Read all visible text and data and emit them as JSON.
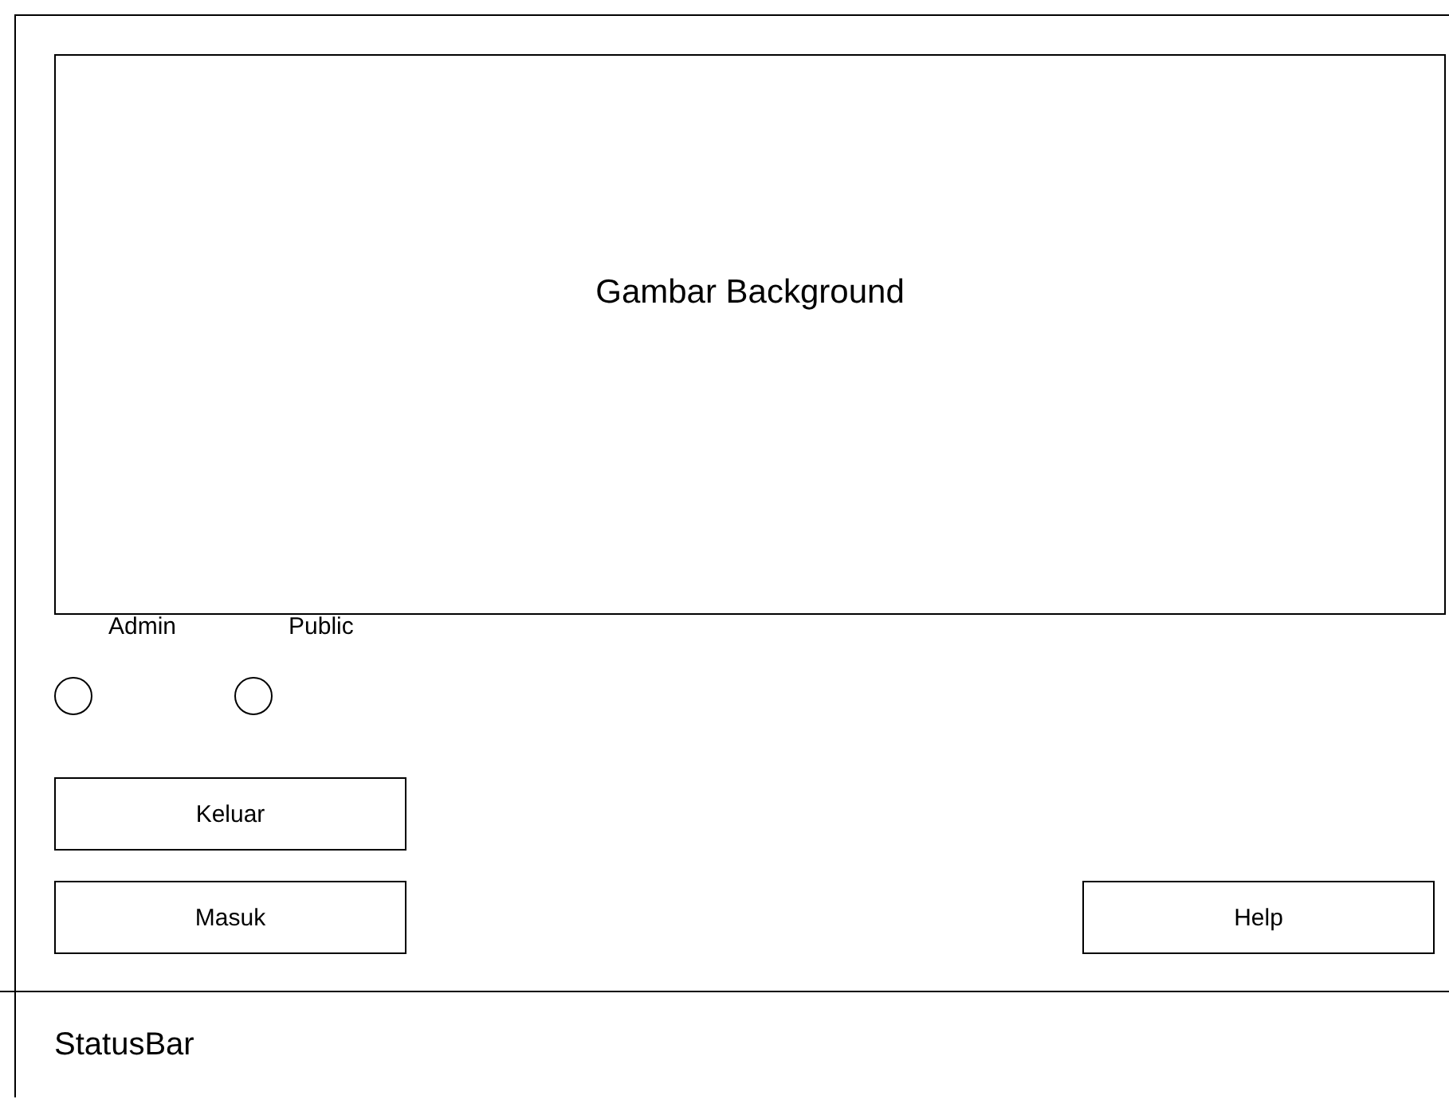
{
  "background_image": {
    "label": "Gambar Background"
  },
  "radios": [
    {
      "label": "Admin",
      "selected": false
    },
    {
      "label": "Public",
      "selected": false
    }
  ],
  "buttons": [
    {
      "label": "Keluar",
      "kind": "left"
    },
    {
      "label": "Masuk",
      "kind": "left"
    },
    {
      "label": "Help",
      "kind": "right"
    }
  ],
  "status_bar": {
    "text": "StatusBar"
  }
}
